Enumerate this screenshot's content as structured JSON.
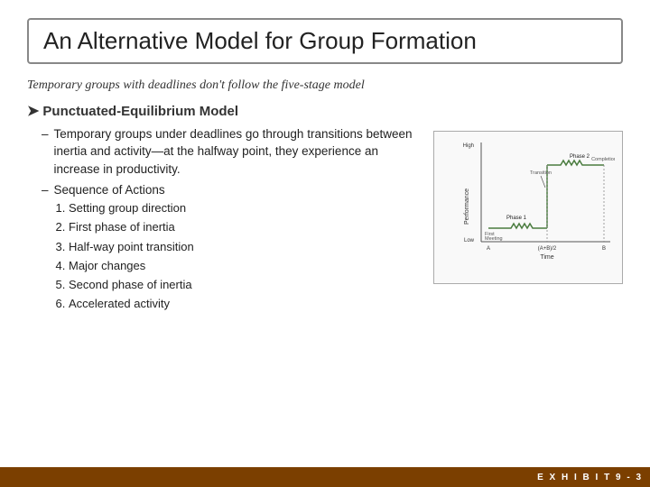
{
  "slide": {
    "title": "An Alternative Model for Group Formation",
    "subtitle": "Temporary groups with deadlines don't follow the five-stage model",
    "bullet_main": "Punctuated-Equilibrium Model",
    "dash1": {
      "dash": "–",
      "text": "Temporary groups under deadlines go through transitions between inertia and activity—at the halfway point, they experience an increase in productivity."
    },
    "dash2": {
      "dash": "–",
      "text": "Sequence of Actions"
    },
    "numbered_items": [
      "Setting group direction",
      "First phase of inertia",
      "Half-way point transition",
      "Major changes",
      "Second phase of inertia",
      "Accelerated activity"
    ],
    "exhibit_label": "E X H I B I T  9 - 3",
    "chart": {
      "y_high": "High",
      "y_low": "Low",
      "x_labels": [
        "A",
        "(A+B)/2",
        "B"
      ],
      "x_axis_label": "Time",
      "y_axis_label": "Performance",
      "phase1_label": "Phase 1",
      "phase2_label": "Phase 2",
      "first_meeting_label": "First Meeting",
      "transition_label": "Transition",
      "completion_label": "Completion"
    }
  }
}
